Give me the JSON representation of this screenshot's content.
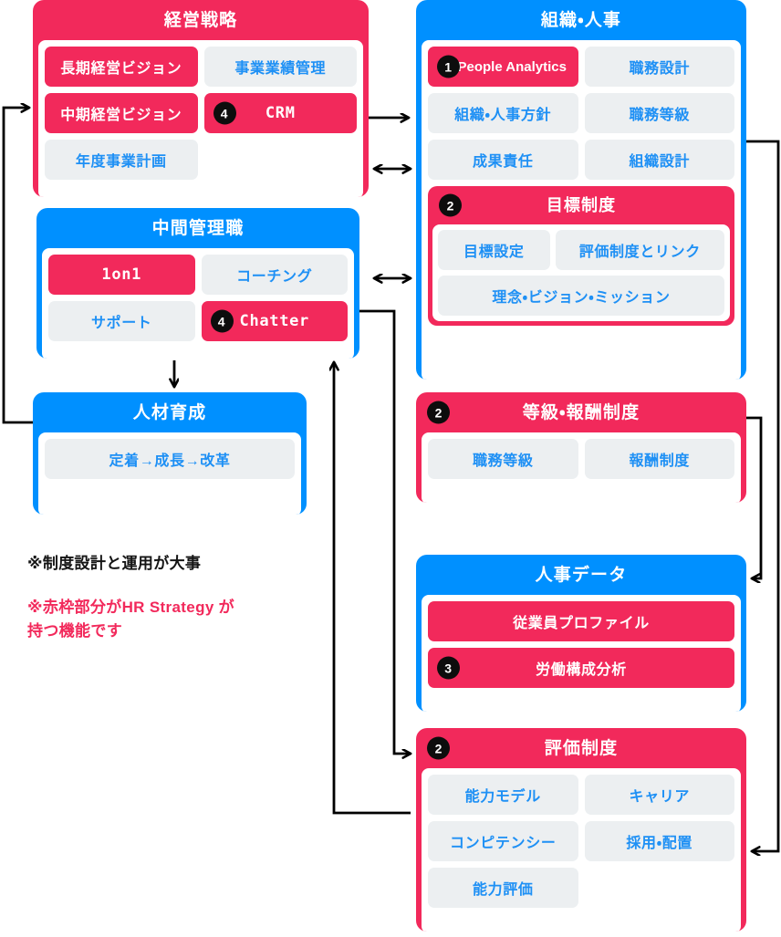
{
  "diagram": {
    "title_note": "※制度設計と運用が大事",
    "legend_note": "※赤枠部分がHR Strategy が\n  持つ機能です",
    "colors": {
      "pink": "#F2295B",
      "blue": "#0090FF",
      "pill_grey": "#ECEFF1",
      "pill_blue_text": "#1E90F5",
      "badge_black": "#0d0d0d",
      "white": "#FFFFFF"
    }
  },
  "cards": {
    "management_strategy": {
      "title": "経営戦略",
      "accent": "pink",
      "items": [
        {
          "label": "長期経営ビジョン",
          "style": "pinkfill"
        },
        {
          "label": "事業業績管理",
          "style": "grey"
        },
        {
          "label": "中期経営ビジョン",
          "style": "pinkfill"
        },
        {
          "label": "CRM",
          "style": "pinkfill",
          "badge": "4"
        },
        {
          "label": "年度事業計画",
          "style": "grey"
        }
      ]
    },
    "middle_management": {
      "title": "中間管理職",
      "accent": "blue",
      "items": [
        {
          "label": "1on1",
          "style": "pinkfill"
        },
        {
          "label": "コーチング",
          "style": "grey"
        },
        {
          "label": "サポート",
          "style": "grey"
        },
        {
          "label": "Chatter",
          "style": "pinkfill",
          "badge": "4"
        }
      ]
    },
    "talent_development": {
      "title": "人材育成",
      "accent": "blue",
      "items": [
        {
          "label": "定着→成長→改革",
          "style": "grey"
        }
      ]
    },
    "organization_hr": {
      "title": "組織・人事",
      "accent": "blue",
      "items": [
        {
          "label": "People Analytics",
          "style": "pinkfill",
          "badge": "1"
        },
        {
          "label": "職務設計",
          "style": "grey"
        },
        {
          "label": "組織・人事方針",
          "style": "grey"
        },
        {
          "label": "職務等級",
          "style": "grey"
        },
        {
          "label": "成果責任",
          "style": "grey"
        },
        {
          "label": "組織設計",
          "style": "grey"
        }
      ],
      "subcard": {
        "title": "目標制度",
        "badge": "2",
        "accent": "pink",
        "items": [
          {
            "label": "目標設定",
            "style": "grey"
          },
          {
            "label": "評価制度とリンク",
            "style": "grey"
          },
          {
            "label": "理念・ビジョン・ミッション",
            "style": "grey"
          }
        ]
      }
    },
    "grade_compensation": {
      "title": "等級・報酬制度",
      "badge": "2",
      "accent": "pink",
      "items": [
        {
          "label": "職務等級",
          "style": "grey"
        },
        {
          "label": "報酬制度",
          "style": "grey"
        }
      ]
    },
    "hr_data": {
      "title": "人事データ",
      "accent": "blue",
      "items": [
        {
          "label": "従業員プロファイル",
          "style": "pinkfill"
        },
        {
          "label": "労働構成分析",
          "style": "pinkfill",
          "badge": "3"
        }
      ]
    },
    "evaluation_system": {
      "title": "評価制度",
      "badge": "2",
      "accent": "pink",
      "items": [
        {
          "label": "能力モデル",
          "style": "grey"
        },
        {
          "label": "キャリア",
          "style": "grey"
        },
        {
          "label": "コンピテンシー",
          "style": "grey"
        },
        {
          "label": "採用・配置",
          "style": "grey"
        },
        {
          "label": "能力評価",
          "style": "grey"
        }
      ]
    }
  },
  "connectors": [
    {
      "name": "strategy-to-organization",
      "kind": "arrow-right"
    },
    {
      "name": "strategy-organization-bidirectional",
      "kind": "arrow-both"
    },
    {
      "name": "middle-management-to-organization",
      "kind": "arrow-both"
    },
    {
      "name": "middle-management-to-talent-development",
      "kind": "arrow-down"
    },
    {
      "name": "talent-development-to-strategy",
      "kind": "arrow-loop-left"
    },
    {
      "name": "organization-to-evaluation",
      "kind": "arrow-loop-right"
    },
    {
      "name": "grade-compensation-to-hr-data",
      "kind": "arrow-loop-right"
    },
    {
      "name": "middle-management-to-evaluation",
      "kind": "arrow-loop-down"
    },
    {
      "name": "evaluation-to-middle-management",
      "kind": "arrow-loop-up"
    }
  ]
}
